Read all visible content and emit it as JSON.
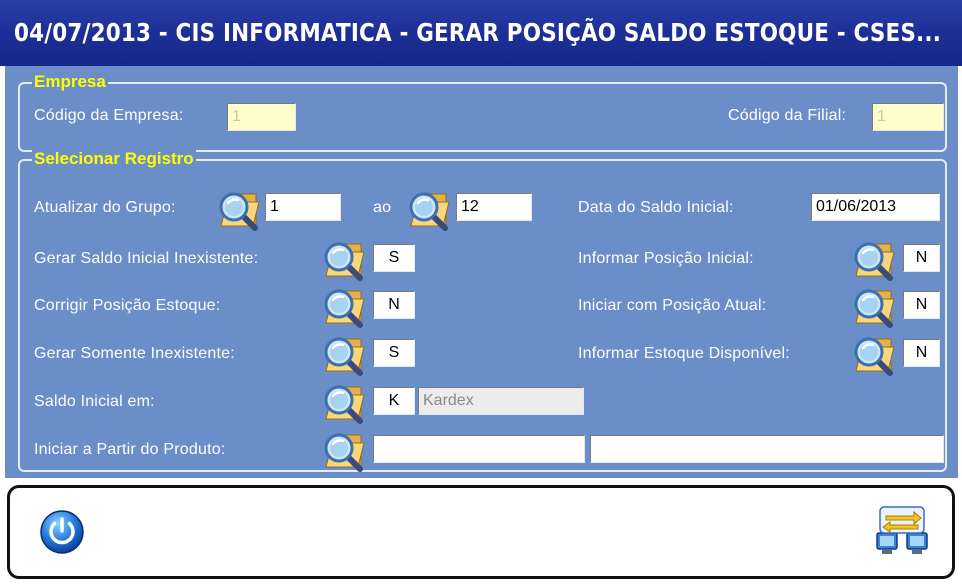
{
  "window": {
    "title": "04/07/2013  -  CIS INFORMATICA  -  GERAR POSIÇÃO SALDO ESTOQUE  -  CSES..."
  },
  "empresa": {
    "legend": "Empresa",
    "codigo_empresa_label": "Código da Empresa:",
    "codigo_empresa_value": "1",
    "codigo_filial_label": "Código da Filial:",
    "codigo_filial_value": "1"
  },
  "selecionar": {
    "legend": "Selecionar Registro",
    "grupo_label": "Atualizar do Grupo:",
    "grupo_de": "1",
    "ao_label": "ao",
    "grupo_ate": "12",
    "data_saldo_label": "Data do Saldo Inicial:",
    "data_saldo_value": "01/06/2013",
    "gerar_saldo_label": "Gerar Saldo Inicial Inexistente:",
    "gerar_saldo_value": "S",
    "informar_posicao_label": "Informar Posição Inicial:",
    "informar_posicao_value": "N",
    "corrigir_label": "Corrigir Posição Estoque:",
    "corrigir_value": "N",
    "iniciar_atual_label": "Iniciar com Posição Atual:",
    "iniciar_atual_value": "N",
    "gerar_somente_label": "Gerar Somente Inexistente:",
    "gerar_somente_value": "S",
    "informar_estoque_label": "Informar Estoque Disponível:",
    "informar_estoque_value": "N",
    "saldo_em_label": "Saldo Inicial em:",
    "saldo_em_code": "K",
    "saldo_em_desc": "Kardex",
    "iniciar_produto_label": "Iniciar a Partir do Produto:",
    "iniciar_produto_code": "",
    "iniciar_produto_desc": ""
  },
  "colors": {
    "titlebar": "#1c2f96",
    "panel": "#6b8ec9",
    "legend": "#ffff00",
    "readonly_field": "#ffffcc"
  },
  "icons": {
    "picker": "magnifier-folder-icon",
    "exit": "power-icon",
    "execute": "computers-transfer-icon"
  }
}
